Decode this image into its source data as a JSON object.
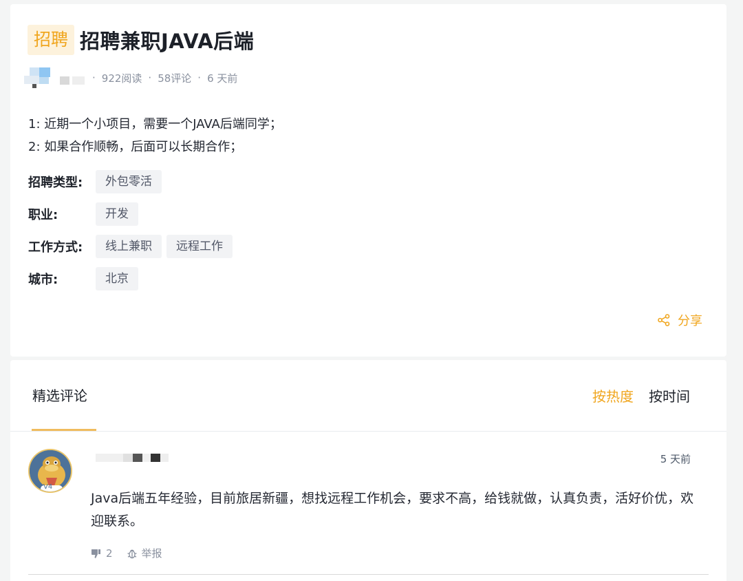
{
  "post": {
    "tag": "招聘",
    "title": "招聘兼职JAVA后端",
    "meta": {
      "reads": "922阅读",
      "comments": "58评论",
      "time": "6 天前",
      "separator": "·"
    },
    "body_lines": [
      "1: 近期一个小项目，需要一个JAVA后端同学；",
      "2: 如果合作顺畅，后面可以长期合作；"
    ],
    "info": {
      "type_label": "招聘类型:",
      "type_values": [
        "外包零活"
      ],
      "job_label": "职业:",
      "job_values": [
        "开发"
      ],
      "work_label": "工作方式:",
      "work_values": [
        "线上兼职",
        "远程工作"
      ],
      "city_label": "城市:",
      "city_values": [
        "北京"
      ]
    },
    "share_label": "分享",
    "share_icon": "share-icon",
    "accent_color": "#f0a61f"
  },
  "comments": {
    "tab_label": "精选评论",
    "sort_hot": "按热度",
    "sort_time": "按时间",
    "items": [
      {
        "time": "5 天前",
        "avatar_badge": "V4",
        "text": "Java后端五年经验，目前旅居新疆，想找远程工作机会，要求不高，给钱就做，认真负责，活好价优，欢迎联系。",
        "dislike_count": "2",
        "report_label": "举报",
        "dislike_icon": "thumbs-down-icon",
        "report_icon": "bug-icon"
      }
    ]
  }
}
